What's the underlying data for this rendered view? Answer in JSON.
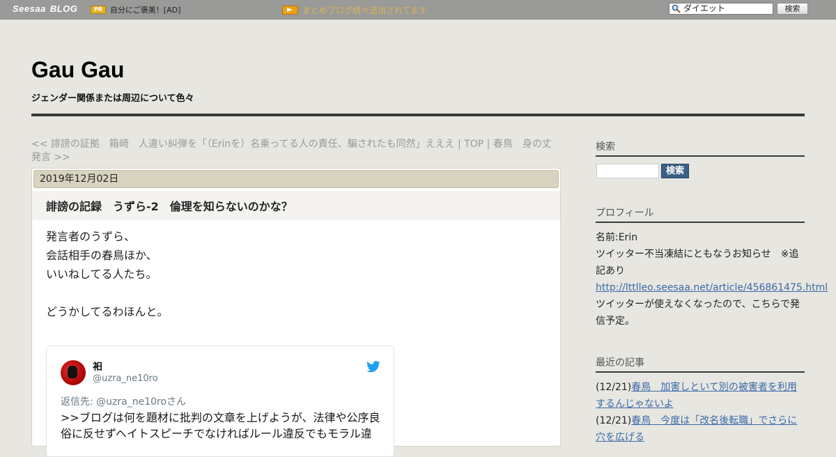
{
  "topbar": {
    "logo_text": "Seesaa",
    "logo_blog": "BLOG",
    "pr_badge": "PR",
    "pr_text": "自分にご褒美！[AD]",
    "matome_link": "まとめブログ続々追加されてます",
    "search_value": "ダイエット",
    "search_button": "検索"
  },
  "header": {
    "site_title": "Gau Gau",
    "site_description": "ジェンダー関係または周辺について色々"
  },
  "breadcrumb": {
    "prev_link": "<< 誹謗の証拠　箱崎　人違い糾弾を「（Erinを）名乗ってる人の責任、騙されたも同然」えええ",
    "separator1": " | ",
    "top_link": "TOP",
    "separator2": " | ",
    "next_link": "春鳥　身の丈発言 >>"
  },
  "post": {
    "date": "2019年12月02日",
    "title": "誹謗の記録　うずら-2　倫理を知らないのかな？",
    "body_lines": [
      "発言者のうずら、",
      "会話相手の春鳥ほか、",
      "いいねしてる人たち。",
      "どうかしてるわほんと。"
    ]
  },
  "tweet": {
    "name": "衵",
    "handle": "@uzra_ne10ro",
    "reply_to": "返信先: @uzra_ne10roさん",
    "text": ">>ブログは何を題材に批判の文章を上げようが、法律や公序良俗に反せずヘイトスピーチでなければルール違反でもモラル違"
  },
  "sidebar": {
    "search_heading": "検索",
    "search_button": "検索",
    "profile_heading": "プロフィール",
    "profile_name": "名前:Erin",
    "profile_notice": "ツイッター不当凍結にともなうお知らせ　※追記あり",
    "profile_link": "http://lttlleo.seesaa.net/article/456861475.html",
    "profile_after": "ツイッターが使えなくなったので、こちらで発信予定。",
    "recent_heading": "最近の記事",
    "recent_items": [
      {
        "date": "(12/21)",
        "title": "春鳥　加害しといて別の被害者を利用するんじゃないよ"
      },
      {
        "date": "(12/21)",
        "title": "春鳥　今度は「改名後転職」でさらに穴を広げる"
      }
    ]
  },
  "colors": {
    "page_bg": "#e7e6e1",
    "topbar_bg": "#9a9a98",
    "date_bar_bg": "#d8d3bf",
    "link": "#3a6aa8",
    "search_button_bg": "#3b5f86",
    "twitter_blue": "#1da1f2"
  }
}
